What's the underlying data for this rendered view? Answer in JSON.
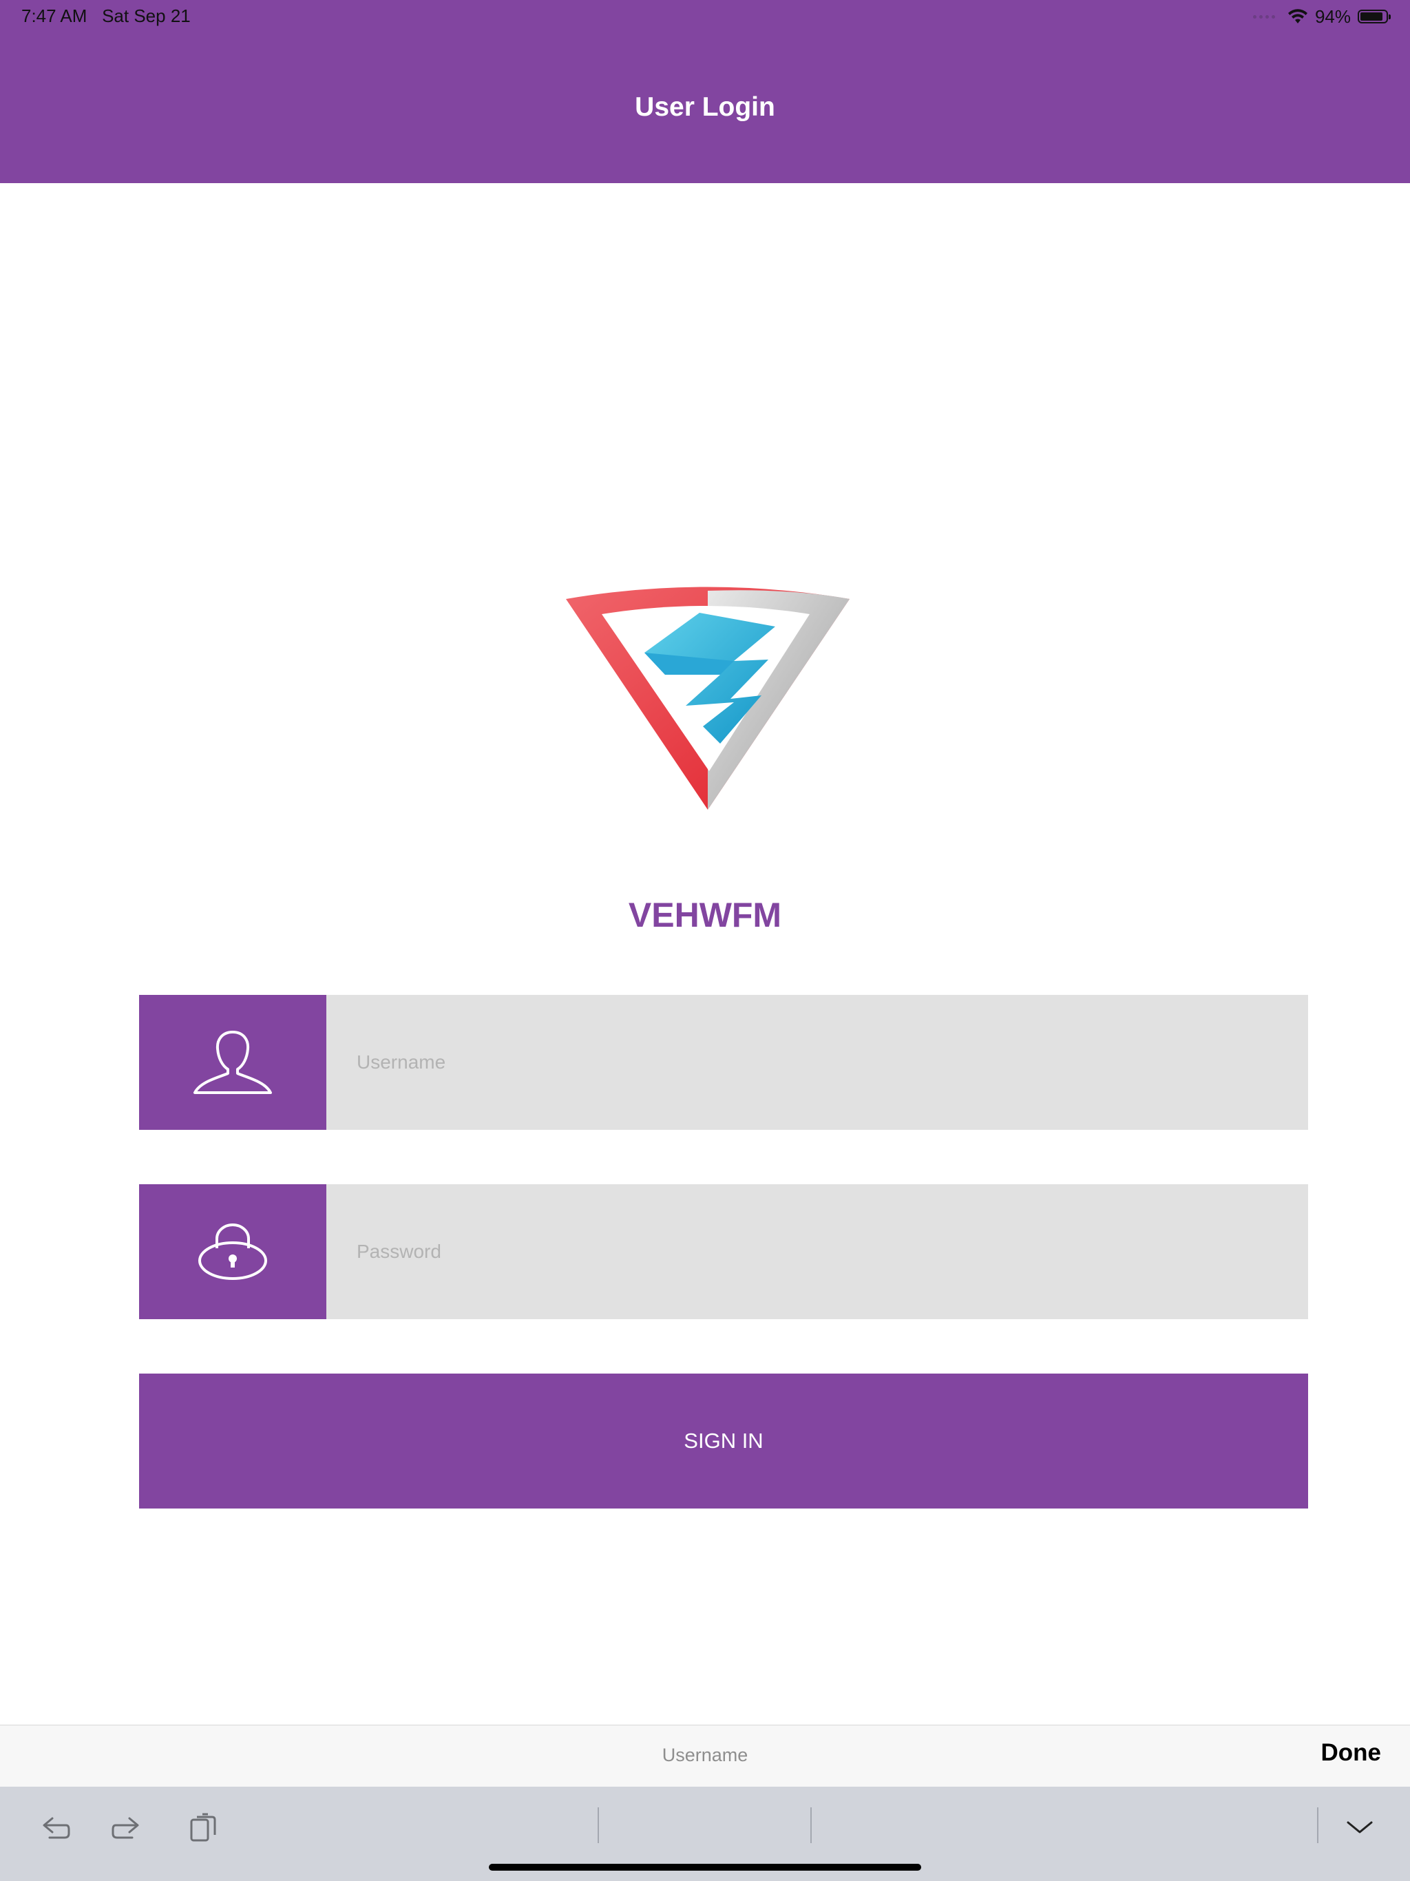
{
  "status_bar": {
    "time": "7:47 AM",
    "date": "Sat Sep 21",
    "battery": "94%",
    "battery_level": 0.94
  },
  "header": {
    "title": "User Login"
  },
  "logo": {
    "name": "shield-logo"
  },
  "app_name": "VEHWFM",
  "username_field": {
    "placeholder": "Username",
    "icon": "user-icon"
  },
  "password_field": {
    "placeholder": "Password",
    "icon": "lock-icon"
  },
  "sign_in": {
    "label": "SIGN IN"
  },
  "keyboard_accessory": {
    "field_label": "Username",
    "done_label": "Done"
  },
  "shortcut_bar": {
    "icons": [
      "undo-icon",
      "redo-icon",
      "paste-icon",
      "keyboard-dismiss-icon"
    ]
  },
  "colors": {
    "brand": "#8245a0",
    "field_bg": "#e1e1e1"
  }
}
